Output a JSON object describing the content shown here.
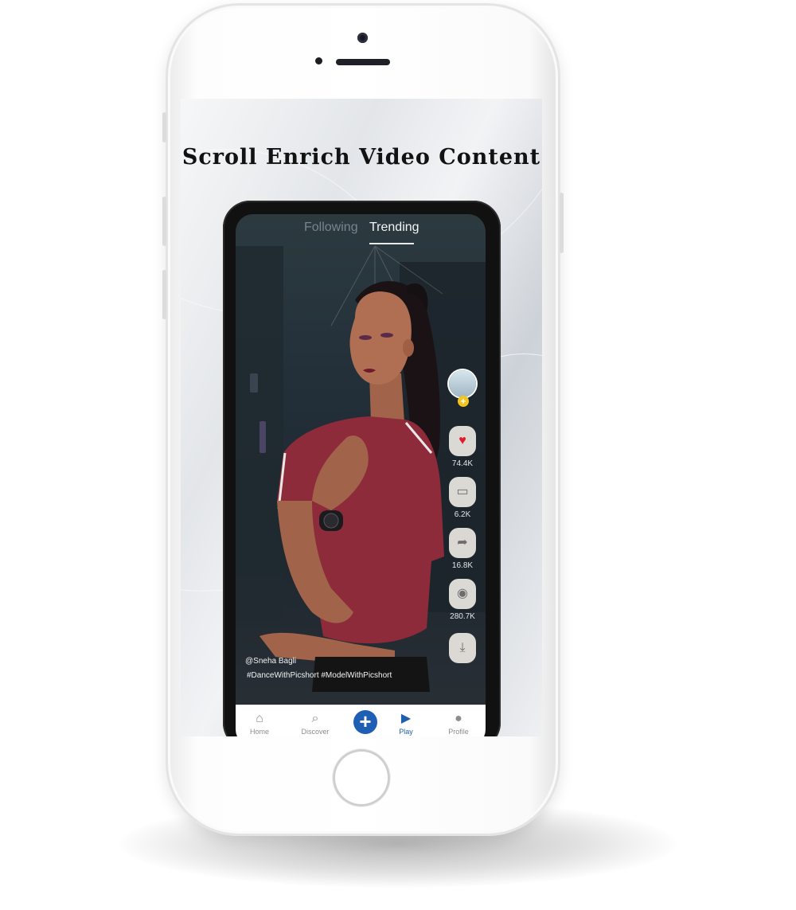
{
  "headline": "Scroll Enrich Video Content",
  "feed_tabs": {
    "following": "Following",
    "trending": "Trending"
  },
  "actions": {
    "like_count": "74.4K",
    "comment_count": "6.2K",
    "share_count": "16.8K",
    "view_count": "280.7K"
  },
  "caption": {
    "username": "@Sneha Bagli",
    "hashtags": "#DanceWithPicshort #ModelWithPicshort"
  },
  "nav": {
    "home": "Home",
    "discover": "Discover",
    "play": "Play",
    "profile": "Profile"
  },
  "colors": {
    "accent_blue": "#1e5fb3",
    "like_red": "#e0192b",
    "follow_yellow": "#f2c41d",
    "shirt_maroon": "#8e2b3b"
  },
  "icons": {
    "home": "home-icon",
    "discover": "search-icon",
    "create": "plus-icon",
    "play": "play-icon",
    "profile": "user-icon",
    "like": "heart-icon",
    "comment": "comment-icon",
    "share": "share-icon",
    "views": "eye-icon",
    "download": "download-icon"
  }
}
